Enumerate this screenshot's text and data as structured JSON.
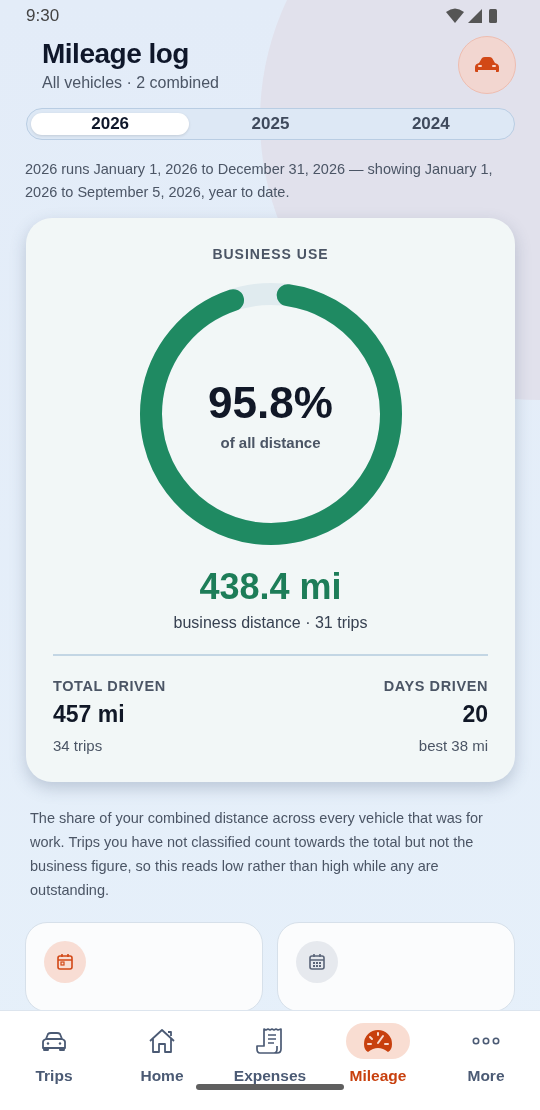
{
  "status_bar": {
    "time": "9:30"
  },
  "header": {
    "title": "Mileage log",
    "subtitle": "All vehicles · 2 combined"
  },
  "year_tabs": [
    {
      "label": "2026",
      "selected": true
    },
    {
      "label": "2025",
      "selected": false
    },
    {
      "label": "2024",
      "selected": false
    }
  ],
  "period_note": "2026 runs January 1, 2026 to December 31, 2026 — showing January 1, 2026 to September 5, 2026, year to date.",
  "business_card": {
    "heading": "BUSINESS USE",
    "percent": "95.8%",
    "percent_caption": "of all distance",
    "level": 0.958,
    "distance": "438.4 mi",
    "distance_caption": "business distance · 31 trips",
    "stats": [
      {
        "label": "TOTAL DRIVEN",
        "value": "457 mi",
        "detail": "34 trips"
      },
      {
        "label": "DAYS DRIVEN",
        "value": "20",
        "detail": "best 38 mi"
      }
    ]
  },
  "explanation": "The share of your combined distance across every vehicle that was for work. Trips you have not classified count towards the total but not the business figure, so this reads low rather than high while any are outstanding.",
  "mini_cards": [
    {
      "kind": "event"
    },
    {
      "kind": "calendar"
    }
  ],
  "nav": [
    {
      "label": "Trips",
      "kind": "car",
      "selected": false
    },
    {
      "label": "Home",
      "kind": "home",
      "selected": false
    },
    {
      "label": "Expenses",
      "kind": "receipt",
      "selected": false
    },
    {
      "label": "Mileage",
      "kind": "gauge",
      "selected": true
    },
    {
      "label": "More",
      "kind": "more",
      "selected": false
    }
  ]
}
